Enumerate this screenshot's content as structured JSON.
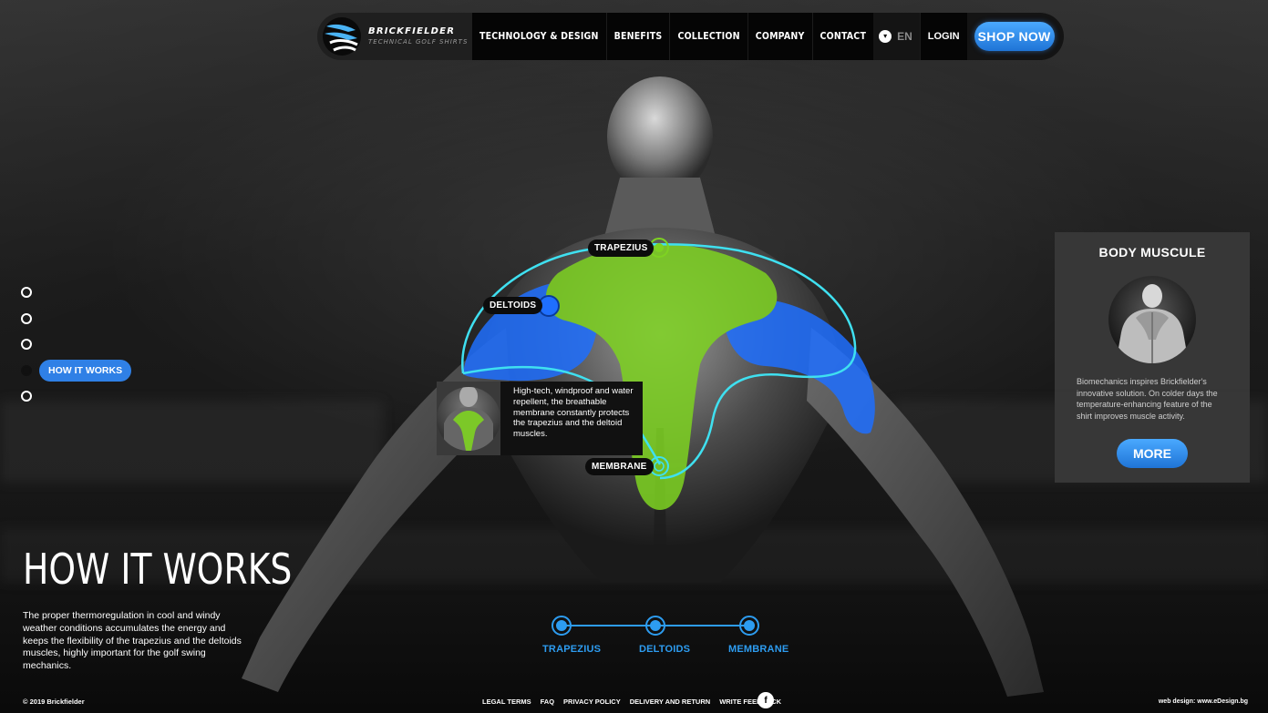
{
  "header": {
    "logo_title": "BRICKFIELDER",
    "logo_subtitle": "TECHNICAL GOLF SHIRTS",
    "nav": [
      "TECHNOLOGY & DESIGN",
      "BENEFITS",
      "COLLECTION",
      "COMPANY",
      "CONTACT"
    ],
    "language": "EN",
    "login": "LOGIN",
    "shop_now": "SHOP NOW"
  },
  "side_nav": {
    "active_label": "HOW IT WORKS",
    "active_index": 3,
    "count": 5
  },
  "points": {
    "trapezius": "TRAPEZIUS",
    "deltoids": "DELTOIDS",
    "membrane": "MEMBRANE"
  },
  "tooltip": {
    "text": "High-tech, windproof and water repellent, the breathable membrane constantly protects the trapezius and the deltoid muscles."
  },
  "card": {
    "title": "BODY MUSCULE",
    "text": "Biomechanics inspires Brickfielder's innovative solution. On colder days the temperature-enhancing feature of the shirt improves muscle activity.",
    "button": "MORE"
  },
  "stepper": [
    "TRAPEZIUS",
    "DELTOIDS",
    "MEMBRANE"
  ],
  "hero": {
    "title": "HOW IT WORKS",
    "text": "The proper thermoregulation in cool and windy weather conditions accumulates the energy and keeps the flexibility of the trapezius and the deltoids muscles, highly important for the golf swing mechanics."
  },
  "footer": {
    "copyright": "© 2019 Brickfielder",
    "links": [
      "LEGAL TERMS",
      "FAQ",
      "PRIVACY POLICY",
      "DELIVERY AND RETURN",
      "WRITE FEEDBACK"
    ],
    "facebook": "f",
    "credit": "web design: www.eDesign.bg"
  },
  "colors": {
    "accent_blue": "#2f80e6",
    "muscle_green": "#7ed321",
    "muscle_blue": "#1f6fff",
    "outline_cyan": "#3fe0f0"
  }
}
